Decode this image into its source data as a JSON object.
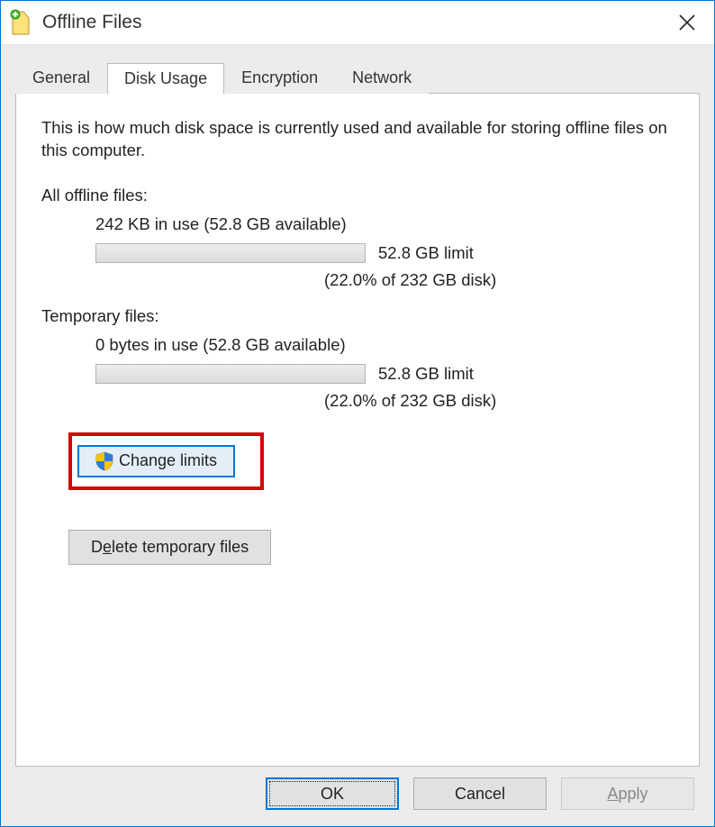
{
  "window": {
    "title": "Offline Files"
  },
  "tabs": {
    "general": "General",
    "disk_usage": "Disk Usage",
    "encryption": "Encryption",
    "network": "Network"
  },
  "panel": {
    "description": "This is how much disk space is currently used and available for storing offline files on this computer.",
    "all_label": "All offline files:",
    "all_usage": "242 KB in use (52.8 GB available)",
    "all_limit": "52.8 GB limit",
    "all_pct": "(22.0% of 232 GB disk)",
    "temp_label": "Temporary files:",
    "temp_usage": "0 bytes in use (52.8 GB available)",
    "temp_limit": "52.8 GB limit",
    "temp_pct": "(22.0% of 232 GB disk)",
    "change_limits": "Change limits",
    "delete_temp_pre": "D",
    "delete_temp_u": "e",
    "delete_temp_post": "lete temporary files"
  },
  "buttons": {
    "ok": "OK",
    "cancel": "Cancel",
    "apply_u": "A",
    "apply_post": "pply"
  }
}
